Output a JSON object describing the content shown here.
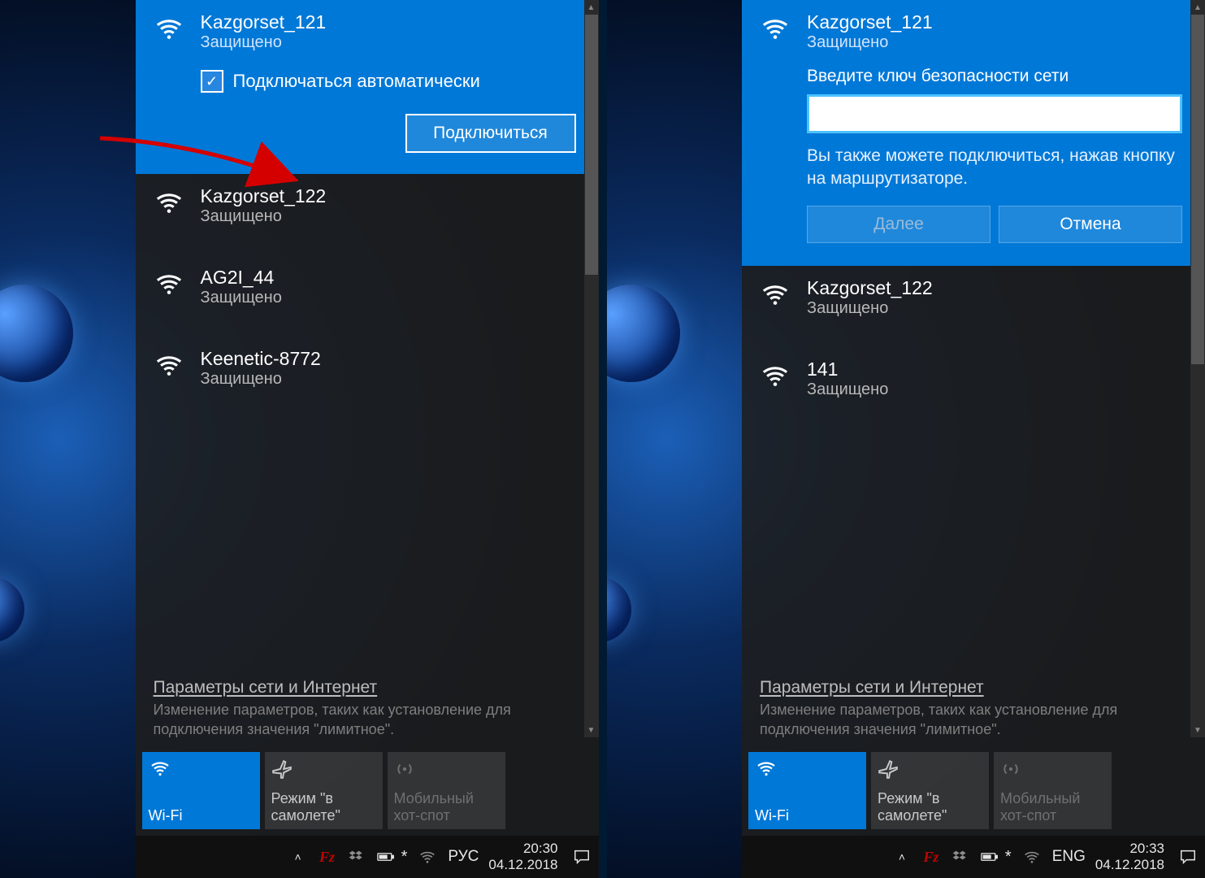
{
  "panels": [
    {
      "selected": {
        "name": "Kazgorset_121",
        "status": "Защищено",
        "auto_label": "Подключаться автоматически",
        "auto_checked": true,
        "connect_label": "Подключиться"
      },
      "networks": [
        {
          "name": "Kazgorset_122",
          "status": "Защищено"
        },
        {
          "name": "AG2I_44",
          "status": "Защищено"
        },
        {
          "name": "Keenetic-8772",
          "status": "Защищено"
        }
      ],
      "settings": {
        "link": "Параметры сети и Интернет",
        "desc": "Изменение параметров, таких как установление для подключения значения \"лимитное\"."
      },
      "tiles": {
        "wifi": "Wi-Fi",
        "airplane": "Режим \"в самолете\"",
        "hotspot": "Мобильный хот-спот"
      },
      "taskbar": {
        "ime": "РУС",
        "time": "20:30",
        "date": "04.12.2018"
      }
    },
    {
      "selected": {
        "name": "Kazgorset_121",
        "status": "Защищено",
        "key_label": "Введите ключ безопасности сети",
        "key_value": "",
        "hint": "Вы также можете подключиться, нажав кнопку на маршрутизаторе.",
        "next_label": "Далее",
        "cancel_label": "Отмена"
      },
      "networks": [
        {
          "name": "Kazgorset_122",
          "status": "Защищено"
        },
        {
          "name": "141",
          "status": "Защищено"
        }
      ],
      "settings": {
        "link": "Параметры сети и Интернет",
        "desc": "Изменение параметров, таких как установление для подключения значения \"лимитное\"."
      },
      "tiles": {
        "wifi": "Wi-Fi",
        "airplane": "Режим \"в самолете\"",
        "hotspot": "Мобильный хот-спот"
      },
      "taskbar": {
        "ime": "ENG",
        "time": "20:33",
        "date": "04.12.2018"
      }
    }
  ]
}
